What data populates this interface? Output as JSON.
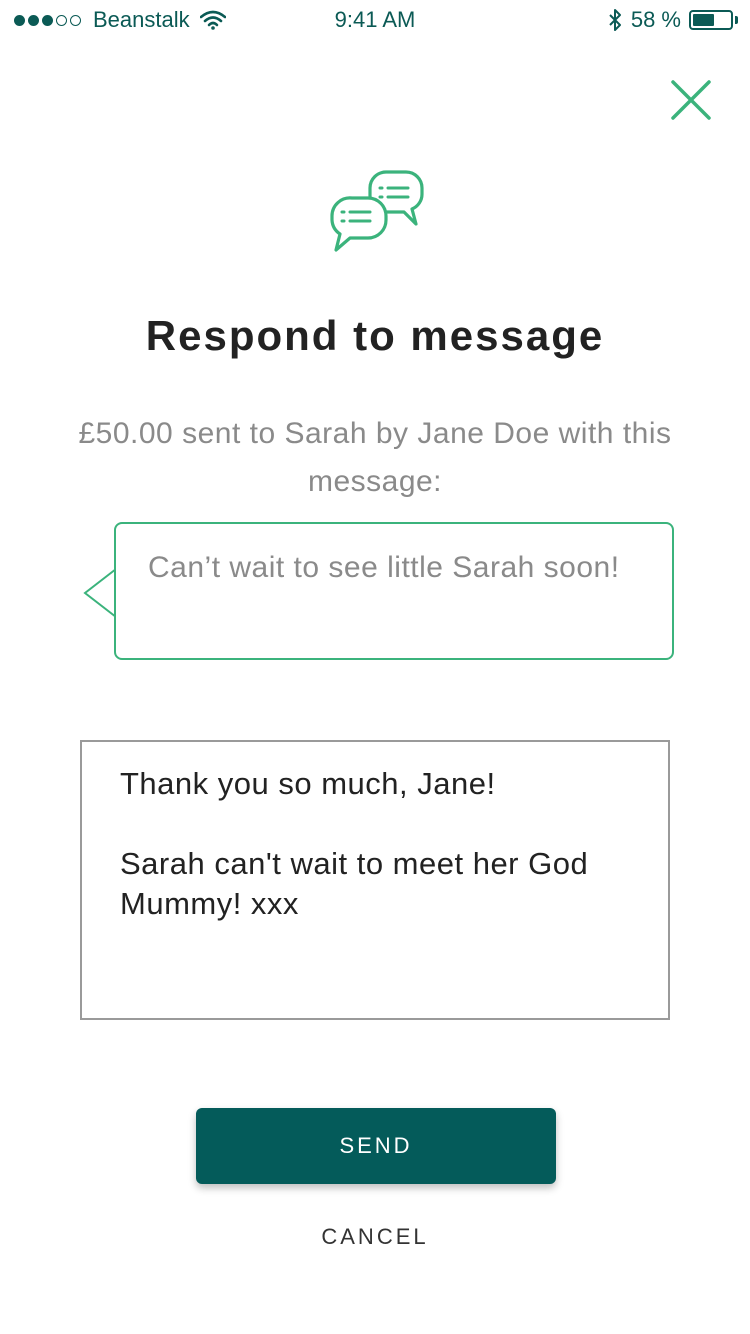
{
  "status_bar": {
    "signal_dots_filled": 3,
    "signal_dots_total": 5,
    "carrier": "Beanstalk",
    "time": "9:41 AM",
    "battery_text": "58 %",
    "battery_level": 0.58,
    "icons": [
      "wifi-icon",
      "bluetooth-icon",
      "battery-icon"
    ]
  },
  "header": {
    "close_icon": "close-icon"
  },
  "dialog": {
    "icon": "chat-bubbles-icon",
    "title": "Respond to message",
    "subtitle": "£50.00 sent to Sarah by Jane Doe with this message:",
    "received_message": "Can’t wait to see little Sarah soon!",
    "reply_text": "Thank you so much, Jane!\n\nSarah can't wait to meet her God Mummy! xxx",
    "send_label": "SEND",
    "cancel_label": "CANCEL"
  },
  "colors": {
    "accent_green": "#3bb37c",
    "primary_teal": "#045b5a",
    "status_teal": "#0b5a55",
    "muted_text": "#8a8a8a"
  }
}
